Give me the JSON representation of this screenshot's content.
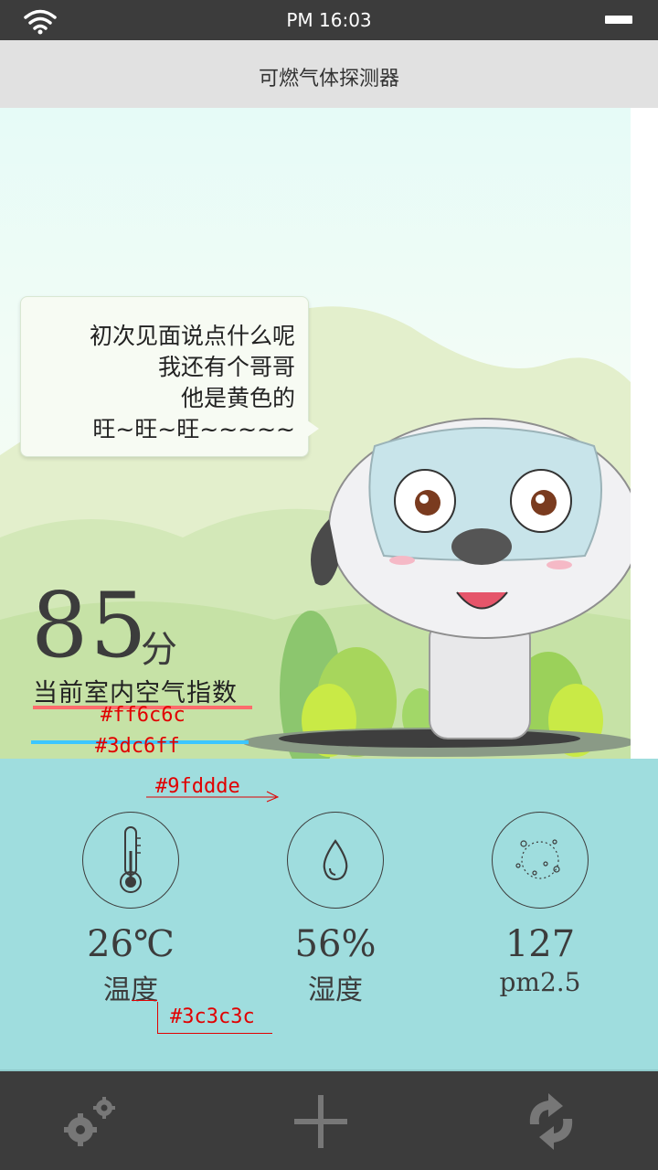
{
  "status_bar": {
    "time": "PM 16:03"
  },
  "title_bar": {
    "title": "可燃气体探测器"
  },
  "bubble": {
    "lines": [
      "初次见面说点什么呢",
      "我还有个哥哥",
      "他是黄色的",
      "旺~旺~旺~~~~~"
    ]
  },
  "score": {
    "value": "85",
    "unit": "分",
    "label": "当前室内空气指数"
  },
  "annotations": {
    "red_bar": "#ff6c6c",
    "blue_bar": "#3dc6ff",
    "panel_bg": "#9fddde",
    "text_color": "#3c3c3c"
  },
  "metrics": [
    {
      "icon": "thermometer-icon",
      "value": "26℃",
      "label": "温度"
    },
    {
      "icon": "droplet-icon",
      "value": "56%",
      "label": "湿度"
    },
    {
      "icon": "particles-icon",
      "value": "127",
      "label": "pm2.5"
    }
  ],
  "nav": [
    {
      "icon": "settings-gears-icon"
    },
    {
      "icon": "plus-icon"
    },
    {
      "icon": "refresh-icon"
    }
  ],
  "colors": {
    "status_bar": "#3c3c3c",
    "title_bar": "#e1e1e1",
    "panel": "#9fddde",
    "nav_bar": "#3c3c3c",
    "icon_gray": "#777777"
  }
}
